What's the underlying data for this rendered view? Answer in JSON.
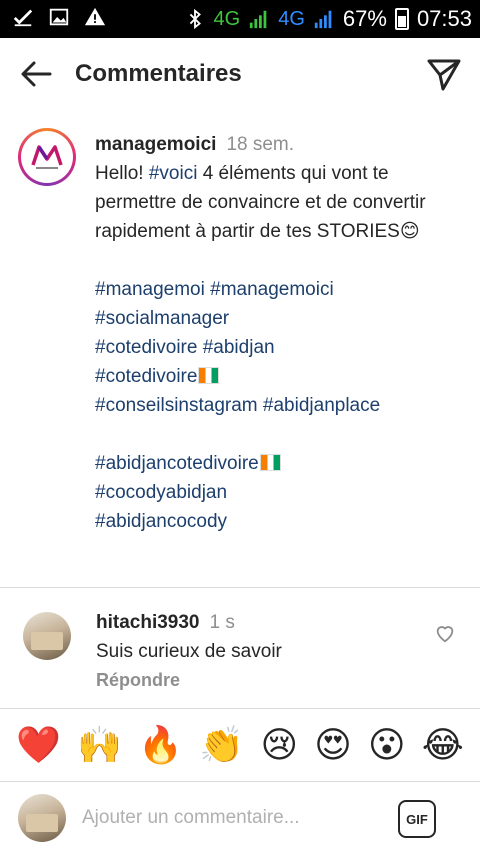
{
  "status_bar": {
    "network_1": "4G",
    "network_2": "4G",
    "battery": "67%",
    "time": "07:53"
  },
  "header": {
    "title": "Commentaires"
  },
  "caption": {
    "username": "managemoici",
    "time": "18 sem.",
    "text_1": "Hello! ",
    "hashtag_voici": "#voici",
    "text_2": " 4 éléments qui vont te permettre de convaincre et de convertir rapidement à partir de tes STORIES😊",
    "tags": [
      "#managemoi #managemoici",
      "#socialmanager",
      "#cotedivoire #abidjan",
      "#cotedivoire",
      "#conseilsinstagram #abidjanplace",
      "#abidjancotedivoire",
      "#cocodyabidjan",
      "#abidjancocody"
    ]
  },
  "comment": {
    "username": "hitachi3930",
    "time": "1 s",
    "text": "Suis curieux de savoir",
    "reply_label": "Répondre"
  },
  "emojis": [
    "❤️",
    "🙌",
    "🔥",
    "👏",
    "😢",
    "😍",
    "😮",
    "😂"
  ],
  "input": {
    "placeholder": "Ajouter un commentaire...",
    "gif_label": "GIF"
  }
}
